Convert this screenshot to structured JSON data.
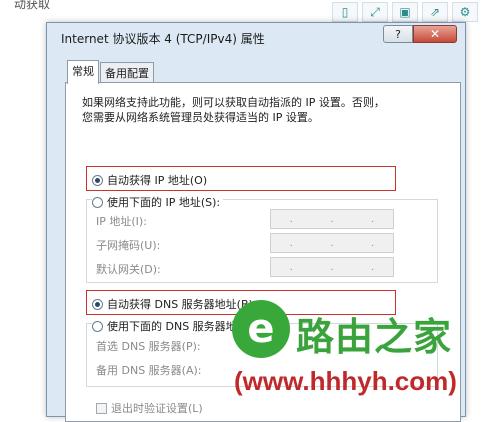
{
  "background_fragment": {
    "text": "动获取"
  },
  "toolbar": {
    "buttons": [
      {
        "icon": "mobile-icon",
        "glyph": "▯"
      },
      {
        "icon": "fullscreen-icon",
        "glyph": "⤢"
      },
      {
        "icon": "save-icon",
        "glyph": "▣"
      },
      {
        "icon": "share-icon",
        "glyph": "⇗"
      },
      {
        "icon": "settings-icon",
        "glyph": "⚙"
      }
    ]
  },
  "dialog": {
    "title": "Internet 协议版本 4 (TCP/IPv4) 属性",
    "help_label": "?",
    "close_label": "✕",
    "tabs": [
      {
        "label": "常规",
        "active": true
      },
      {
        "label": "备用配置",
        "active": false
      }
    ],
    "intro_line1": "如果网络支持此功能，则可以获取自动指派的 IP 设置。否则，",
    "intro_line2": "您需要从网络系统管理员处获得适当的 IP 设置。",
    "ip_auto_label": "自动获得 IP 地址(O)",
    "ip_manual_label": "使用下面的 IP 地址(S):",
    "ip_fields": [
      {
        "label": "IP 地址(I):"
      },
      {
        "label": "子网掩码(U):"
      },
      {
        "label": "默认网关(D):"
      }
    ],
    "dns_auto_label": "自动获得 DNS 服务器地址(B)",
    "dns_manual_label": "使用下面的 DNS 服务器地址(E):",
    "dns_fields": [
      {
        "label": "首选 DNS 服务器(P):"
      },
      {
        "label": "备用 DNS 服务器(A):"
      }
    ],
    "validate_label": "退出时验证设置(L)",
    "ip_dots": "."
  },
  "watermark": {
    "brand": "路由之家",
    "logo_letter": "e",
    "url": "(www.hhhyh.com)"
  },
  "colors": {
    "highlight_border": "#c9332d",
    "dialog_background": "#dce9f4",
    "watermark_green": "#3aa33c",
    "watermark_red": "#c0292a"
  }
}
